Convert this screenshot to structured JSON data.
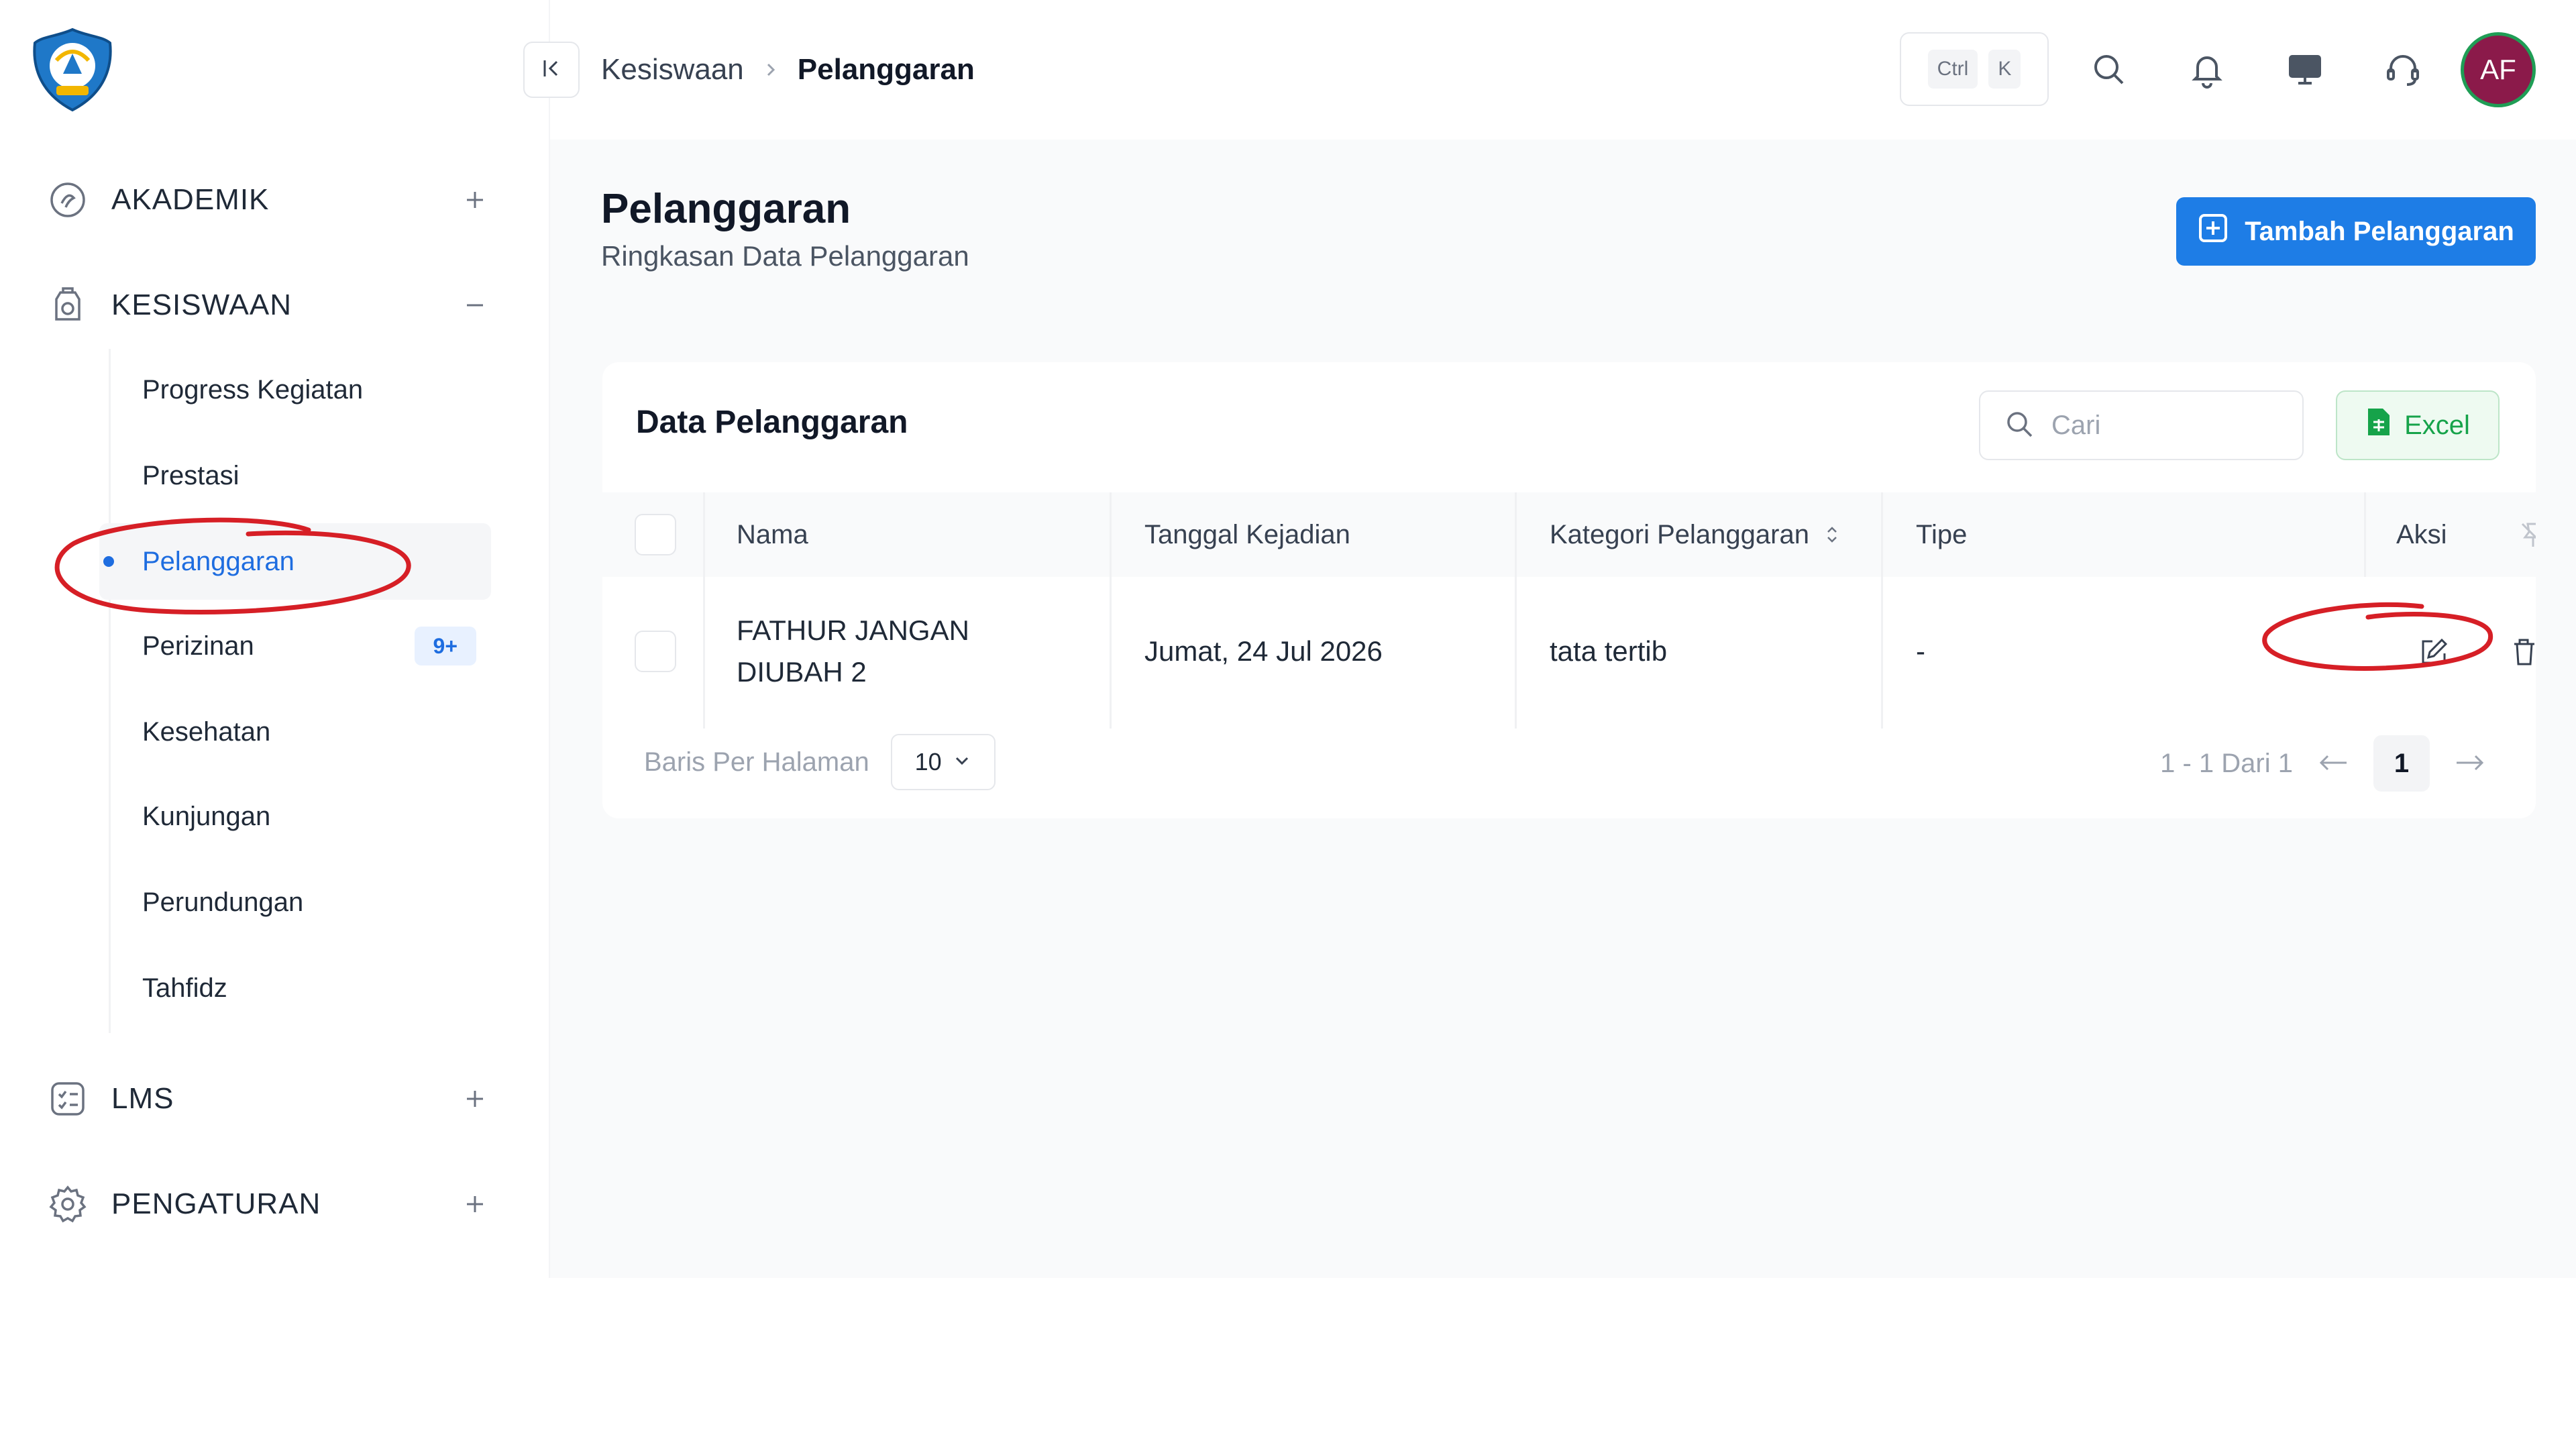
{
  "sidebar": {
    "groups": [
      {
        "label": "AKADEMIK",
        "icon": "academic-icon",
        "expanded": false
      },
      {
        "label": "KESISWAAN",
        "icon": "student-affairs-icon",
        "expanded": true
      },
      {
        "label": "LMS",
        "icon": "lms-icon",
        "expanded": false
      },
      {
        "label": "PENGATURAN",
        "icon": "gear-icon",
        "expanded": false
      }
    ],
    "sub_items": [
      {
        "label": "Progress Kegiatan"
      },
      {
        "label": "Prestasi"
      },
      {
        "label": "Pelanggaran",
        "active": true
      },
      {
        "label": "Perizinan",
        "badge": "9+"
      },
      {
        "label": "Kesehatan"
      },
      {
        "label": "Kunjungan"
      },
      {
        "label": "Perundungan"
      },
      {
        "label": "Tahfidz"
      }
    ]
  },
  "topbar": {
    "breadcrumb": [
      "Kesiswaan",
      "Pelanggaran"
    ],
    "shortcut": [
      "Ctrl",
      "K"
    ],
    "avatar_initials": "AF",
    "icons": [
      "search-icon",
      "bell-icon",
      "monitor-icon",
      "headset-icon"
    ]
  },
  "page": {
    "title": "Pelanggaran",
    "subtitle": "Ringkasan Data Pelanggaran",
    "add_button": "Tambah Pelanggaran"
  },
  "table": {
    "title": "Data Pelanggaran",
    "search_placeholder": "Cari",
    "excel_button": "Excel",
    "columns": [
      "Nama",
      "Tanggal Kejadian",
      "Kategori Pelanggaran",
      "Tipe",
      "Aksi"
    ],
    "rows": [
      {
        "nama_line1": "FATHUR JANGAN",
        "nama_line2": "DIUBAH 2",
        "tanggal": "Jumat, 24 Jul 2026",
        "kategori": "tata tertib",
        "tipe": "-"
      }
    ],
    "rows_per_page_label": "Baris Per Halaman",
    "rows_per_page": "10",
    "range_text": "1 - 1 Dari 1",
    "current_page": "1"
  },
  "colors": {
    "accent": "#1e7de6",
    "active_text": "#1e6de0",
    "excel_green": "#16a34a",
    "avatar_bg": "#8b1a4a",
    "annotation_red": "#d61f26"
  }
}
